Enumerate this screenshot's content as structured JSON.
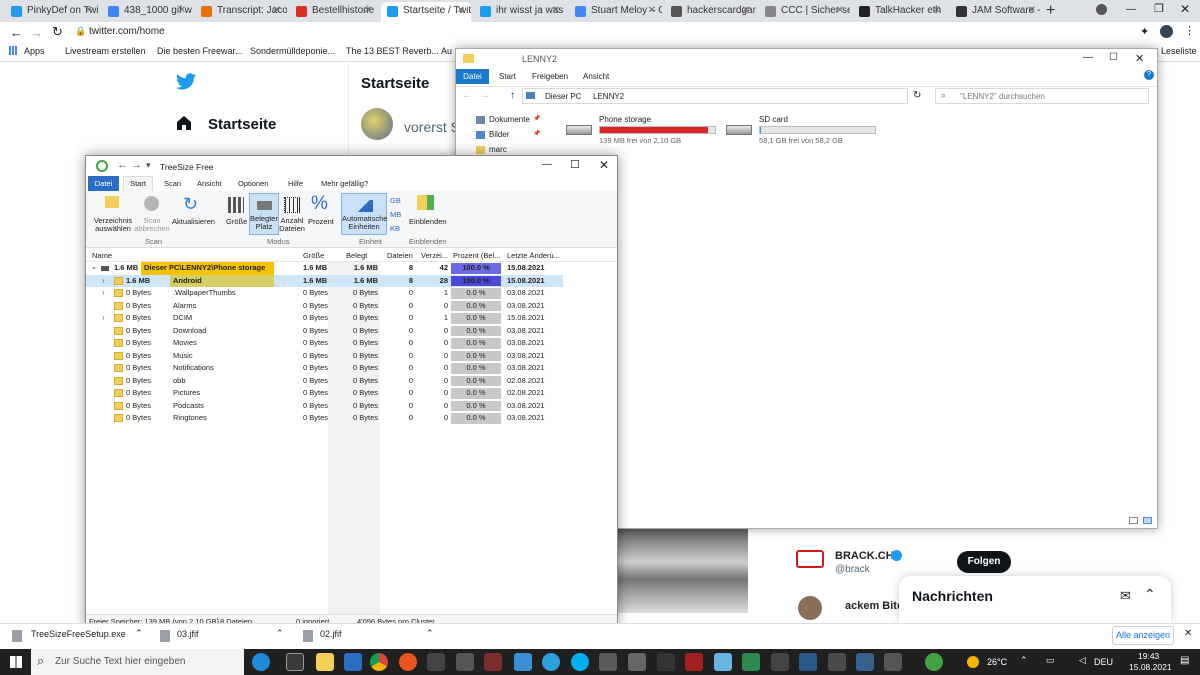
{
  "browser": {
    "tabs": [
      {
        "label": "PinkyDef on Twi",
        "color": "#1d9bf0"
      },
      {
        "label": "438_1000 gif wi",
        "color": "#4285f4"
      },
      {
        "label": "Transcript: Jacob",
        "color": "#e8710a"
      },
      {
        "label": "Bestellhistorie",
        "color": "#d93025"
      },
      {
        "label": "Startseite / Twitt",
        "color": "#1d9bf0"
      },
      {
        "label": "ihr wisst ja was",
        "color": "#1d9bf0"
      },
      {
        "label": "Stuart Meloy – C",
        "color": "#4285f4"
      },
      {
        "label": "hackerscardgam",
        "color": "#555555"
      },
      {
        "label": "CCC | Sicher sei",
        "color": "#888888"
      },
      {
        "label": "TalkHacker eth",
        "color": "#222222"
      },
      {
        "label": "JAM Software -",
        "color": "#333333"
      }
    ],
    "url": "twitter.com/home",
    "bookmarks": [
      "Apps",
      "Livestream erstellen",
      "Die besten Freewar...",
      "Sondermülldeponie...",
      "The 13 BEST Reverb...",
      "Au"
    ],
    "reading_list": "Leseliste"
  },
  "twitter": {
    "home_nav": "Startseite",
    "header": "Startseite",
    "compose_placeholder": "vorerst S",
    "suggest_name": "BRACK.CH",
    "suggest_handle": "@brack",
    "follow": "Folgen",
    "suggest2": "ackem Bitc",
    "messages": "Nachrichten"
  },
  "explorer": {
    "title": "LENNY2",
    "tabs": [
      "Datei",
      "Start",
      "Freigeben",
      "Ansicht"
    ],
    "breadcrumb": [
      "Dieser PC",
      "LENNY2"
    ],
    "search_placeholder": "\"LENNY2\" durchsuchen",
    "nav": [
      {
        "label": "Dokumente"
      },
      {
        "label": "Bilder"
      },
      {
        "label": "marc"
      }
    ],
    "drives": [
      {
        "name": "Phone storage",
        "free": "139 MB frei von 2,10 GB",
        "used_fraction": 0.935,
        "bar_color": "#da2626"
      },
      {
        "name": "SD card",
        "free": "58,1 GB frei von 58,2 GB",
        "used_fraction": 0.002,
        "bar_color": "#26a0da"
      }
    ]
  },
  "treesize": {
    "title": "TreeSize Free",
    "menu": [
      "Datei",
      "Start",
      "Scan",
      "Ansicht",
      "Optionen",
      "Hilfe",
      "Mehr gefällig?"
    ],
    "ribbon": {
      "scan": [
        "Verzeichnis auswählen",
        "Scan abbrechen",
        "Aktualisieren"
      ],
      "scan_group": "Scan",
      "modus": [
        "Größe",
        "Belegter Platz",
        "Anzahl Dateien",
        "Prozent"
      ],
      "modus_group": "Modus",
      "einheit": [
        "Automatische Einheiten"
      ],
      "units": [
        "GB",
        "MB",
        "KB"
      ],
      "einheit_group": "Einheit",
      "einblenden": "Einblenden",
      "einblenden_group": "Einblenden"
    },
    "columns": [
      "Name",
      "Größe",
      "Belegt",
      "Dateien",
      "Verzei...",
      "Prozent (Bel...",
      "Letzte Änderu..."
    ],
    "rows": [
      {
        "size_label": "1.6 MB",
        "name": "Dieser PC\\LENNY2\\Phone storage",
        "groesse": "1.6 MB",
        "belegt": "1.6 MB",
        "dateien": "8",
        "verz": "42",
        "pct": "100.0 %",
        "pct_value": 100,
        "date": "15.08.2021",
        "level": 0,
        "bold": true,
        "hl": "#f5c400"
      },
      {
        "size_label": "1.6 MB",
        "name": "Android",
        "groesse": "1.6 MB",
        "belegt": "1.6 MB",
        "dateien": "8",
        "verz": "28",
        "pct": "100.0 %",
        "pct_value": 100,
        "date": "15.08.2021",
        "level": 1,
        "bold": true,
        "hl": "#d6cf64"
      },
      {
        "size_label": "0 Bytes",
        "name": ".WallpaperThumbs",
        "groesse": "0 Bytes",
        "belegt": "0 Bytes",
        "dateien": "0",
        "verz": "1",
        "pct": "0.0 %",
        "pct_value": 0,
        "date": "03.08.2021",
        "level": 1
      },
      {
        "size_label": "0 Bytes",
        "name": "Alarms",
        "groesse": "0 Bytes",
        "belegt": "0 Bytes",
        "dateien": "0",
        "verz": "0",
        "pct": "0.0 %",
        "pct_value": 0,
        "date": "03.08.2021",
        "level": 1
      },
      {
        "size_label": "0 Bytes",
        "name": "DCIM",
        "groesse": "0 Bytes",
        "belegt": "0 Bytes",
        "dateien": "0",
        "verz": "1",
        "pct": "0.0 %",
        "pct_value": 0,
        "date": "15.08.2021",
        "level": 1
      },
      {
        "size_label": "0 Bytes",
        "name": "Download",
        "groesse": "0 Bytes",
        "belegt": "0 Bytes",
        "dateien": "0",
        "verz": "0",
        "pct": "0.0 %",
        "pct_value": 0,
        "date": "03.08.2021",
        "level": 1
      },
      {
        "size_label": "0 Bytes",
        "name": "Movies",
        "groesse": "0 Bytes",
        "belegt": "0 Bytes",
        "dateien": "0",
        "verz": "0",
        "pct": "0.0 %",
        "pct_value": 0,
        "date": "03.08.2021",
        "level": 1
      },
      {
        "size_label": "0 Bytes",
        "name": "Music",
        "groesse": "0 Bytes",
        "belegt": "0 Bytes",
        "dateien": "0",
        "verz": "0",
        "pct": "0.0 %",
        "pct_value": 0,
        "date": "03.08.2021",
        "level": 1
      },
      {
        "size_label": "0 Bytes",
        "name": "Notifications",
        "groesse": "0 Bytes",
        "belegt": "0 Bytes",
        "dateien": "0",
        "verz": "0",
        "pct": "0.0 %",
        "pct_value": 0,
        "date": "03.08.2021",
        "level": 1
      },
      {
        "size_label": "0 Bytes",
        "name": "obb",
        "groesse": "0 Bytes",
        "belegt": "0 Bytes",
        "dateien": "0",
        "verz": "0",
        "pct": "0.0 %",
        "pct_value": 0,
        "date": "02.08.2021",
        "level": 1
      },
      {
        "size_label": "0 Bytes",
        "name": "Pictures",
        "groesse": "0 Bytes",
        "belegt": "0 Bytes",
        "dateien": "0",
        "verz": "0",
        "pct": "0.0 %",
        "pct_value": 0,
        "date": "02.08.2021",
        "level": 1
      },
      {
        "size_label": "0 Bytes",
        "name": "Podcasts",
        "groesse": "0 Bytes",
        "belegt": "0 Bytes",
        "dateien": "0",
        "verz": "0",
        "pct": "0.0 %",
        "pct_value": 0,
        "date": "03.08.2021",
        "level": 1
      },
      {
        "size_label": "0 Bytes",
        "name": "Ringtones",
        "groesse": "0 Bytes",
        "belegt": "0 Bytes",
        "dateien": "0",
        "verz": "0",
        "pct": "0.0 %",
        "pct_value": 0,
        "date": "03.08.2021",
        "level": 1
      }
    ],
    "status": [
      "Freier Speicher: 139 MB (von 2,10 GB)",
      "8 Dateien",
      "0 ignoriert",
      "4'096 Bytes pro Cluster"
    ]
  },
  "downloads": {
    "items": [
      "TreeSizeFreeSetup.exe",
      "03.jfif",
      "02.jfif"
    ],
    "show_all": "Alle anzeigen"
  },
  "taskbar": {
    "search_placeholder": "Zur Suche Text hier eingeben",
    "weather": "26°C",
    "lang": "DEU",
    "time": "19:43",
    "date": "15.08.2021"
  }
}
